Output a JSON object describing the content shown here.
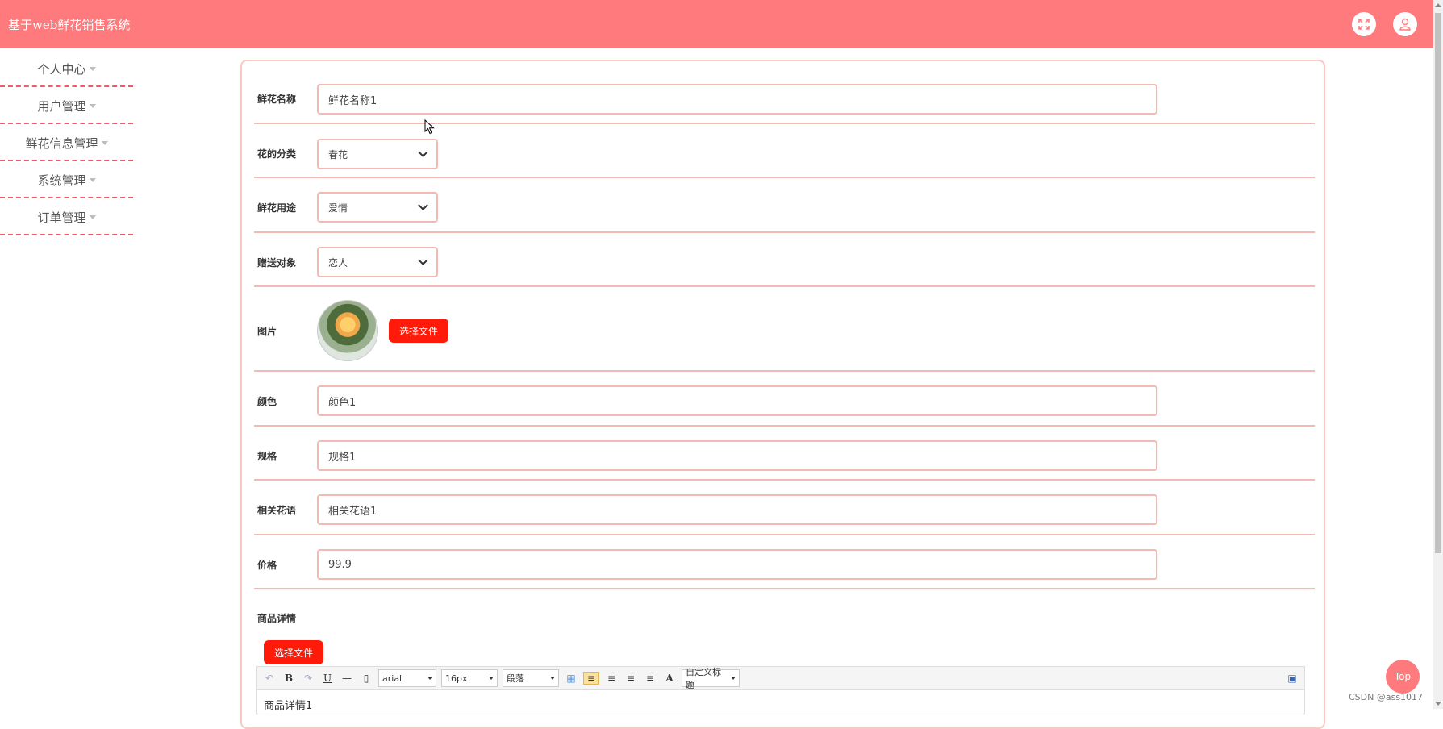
{
  "app": {
    "title": "基于web鲜花销售系统"
  },
  "header": {
    "fullscreen_icon": "fullscreen-icon",
    "user_icon": "user-icon",
    "bg_color": "#fe7a7c"
  },
  "sidebar": {
    "items": [
      {
        "label": "个人中心"
      },
      {
        "label": "用户管理"
      },
      {
        "label": "鲜花信息管理"
      },
      {
        "label": "系统管理"
      },
      {
        "label": "订单管理"
      }
    ]
  },
  "form": {
    "name": {
      "label": "鲜花名称",
      "value": "鲜花名称1"
    },
    "category": {
      "label": "花的分类",
      "value": "春花"
    },
    "usage": {
      "label": "鲜花用途",
      "value": "爱情"
    },
    "recipient": {
      "label": "赠送对象",
      "value": "恋人"
    },
    "image": {
      "label": "图片",
      "button": "选择文件"
    },
    "color": {
      "label": "颜色",
      "value": "颜色1"
    },
    "spec": {
      "label": "规格",
      "value": "规格1"
    },
    "flower_lang": {
      "label": "相关花语",
      "value": "相关花语1"
    },
    "price": {
      "label": "价格",
      "value": "99.9"
    },
    "detail": {
      "label": "商品详情",
      "button": "选择文件",
      "content": "商品详情1"
    }
  },
  "editor": {
    "font_family": "arial",
    "font_size": "16px",
    "paragraph": "段落",
    "custom_heading": "自定义标题",
    "bold": "B",
    "underline": "U",
    "font_color": "A"
  },
  "top_button": "Top",
  "watermark": "CSDN @ass1017",
  "colors": {
    "accent": "#fe7a7c",
    "button_red": "#ff1a0a",
    "border": "#f5b9b3"
  }
}
